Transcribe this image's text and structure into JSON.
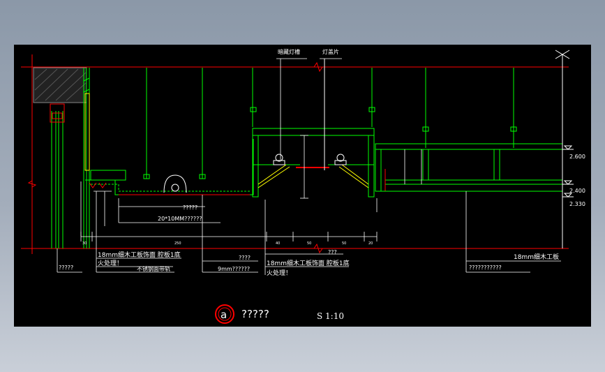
{
  "drawing": {
    "callouts": {
      "top_left_label": "暗藏灯槽",
      "top_right_label": "灯盖片",
      "label_q5_a": "?????",
      "label_20x10": "20*10MM??????",
      "label_18mm_a": "18mm细木工板饰面 腔板1底",
      "label_treat_a": "火处理！",
      "label_bottom_left_a": "不锈钢面带轨",
      "label_q4": "????",
      "label_9mm": "9mm??????",
      "label_18mm_b": "18mm细木工板饰面 腔板1底",
      "label_treat_b": "火处理！",
      "label_q3": "???",
      "label_18mm_right": "18mm细木工板",
      "label_right_long": "???????????",
      "label_left_q5": "?????"
    },
    "levels": [
      "2.600",
      "2.400",
      "2.330"
    ],
    "detail_mark": "a",
    "detail_title": "?????",
    "scale": "S 1:10"
  },
  "colors": {
    "background": "#000000",
    "line_green": "#00ff00",
    "line_red": "#ff0000",
    "line_white": "#ffffff",
    "line_yellow": "#ffff00",
    "page_bg": "#98a4b3"
  }
}
